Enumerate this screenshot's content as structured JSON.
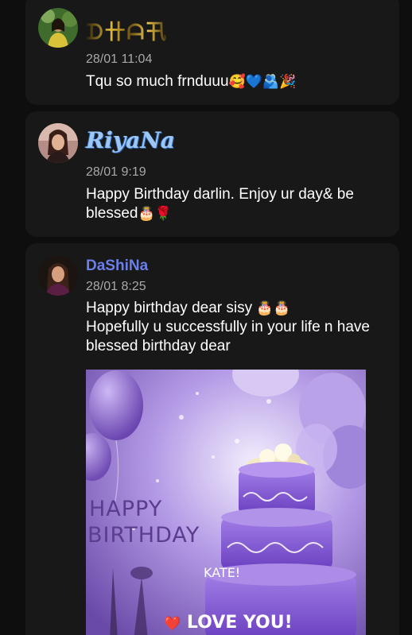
{
  "comments": [
    {
      "author": "ᗪ卄ᗩ卂",
      "avatar_icon": "user-avatar-photo",
      "time": "28/01 11:04",
      "text": "Tqu so much frnduuu",
      "emojis": "🥰💙🫂🎉"
    },
    {
      "author": "RiyaNa",
      "avatar_icon": "user-avatar-photo",
      "time": "28/01 9:19",
      "text": "Happy Birthday darlin. Enjoy ur day& be blessed",
      "emojis": "🎂🌹"
    },
    {
      "author": "DaShiNa",
      "avatar_icon": "user-avatar-photo",
      "time": "28/01 8:25",
      "text_line1": "Happy birthday dear sisy",
      "text_line1_emojis": "🎂🎂",
      "text_rest": "Hopefully u successfully in your life n have blessed birthday dear",
      "media": {
        "icon": "birthday-cake-gif",
        "line1": "HAPPY",
        "line2": "BIRTHDAY",
        "name": "KATE!",
        "footer": "LOVE YOU!",
        "footer_emoji": "❤️"
      }
    }
  ],
  "colors": {
    "background": "#0e0e0e",
    "card": "#181818",
    "timestamp": "#a9a9a9",
    "author_link": "#6c7ee8"
  }
}
